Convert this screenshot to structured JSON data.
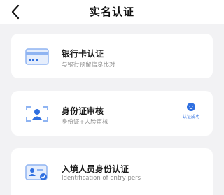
{
  "header": {
    "title": "实名认证",
    "back_icon": "chevron-left-icon"
  },
  "cards": [
    {
      "icon": "bank-card-icon",
      "title": "银行卡认证",
      "subtitle": "与银行预留信息比对"
    },
    {
      "icon": "face-scan-icon",
      "title": "身份证审核",
      "subtitle": "身份证+人脸审核",
      "status_icon": "smile-badge-icon",
      "status_text": "认证成功"
    },
    {
      "icon": "id-card-verified-icon",
      "title": "入境人员身份认证",
      "subtitle": "Identification of entry pers"
    }
  ],
  "colors": {
    "accent": "#2f6fe0",
    "icon_light": "#8fb4f2",
    "background": "#f2f2f4"
  }
}
